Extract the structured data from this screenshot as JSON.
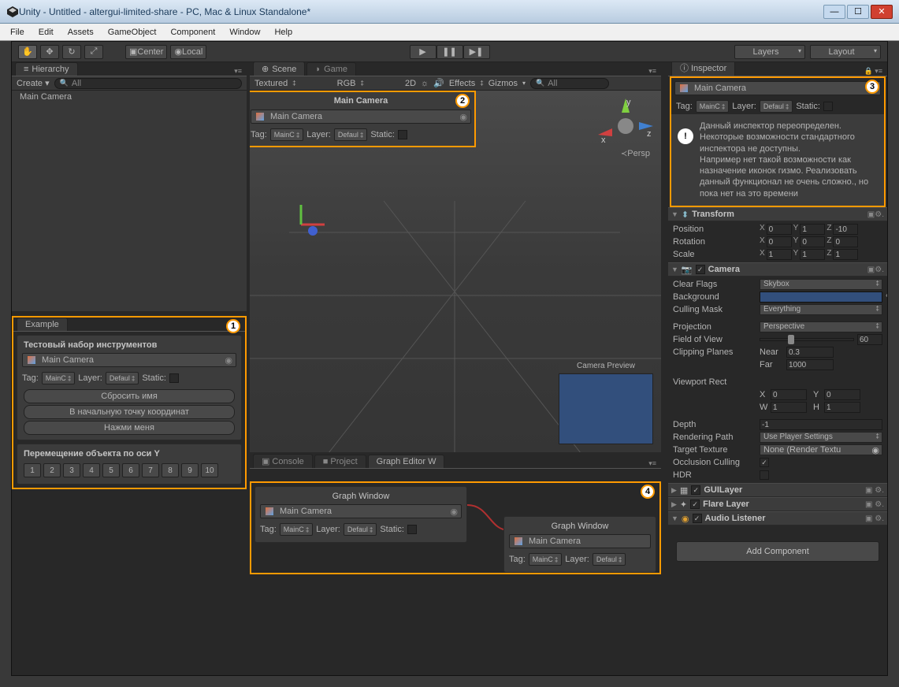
{
  "window": {
    "title": "Unity - Untitled - altergui-limited-share - PC, Mac & Linux Standalone*"
  },
  "menu": [
    "File",
    "Edit",
    "Assets",
    "GameObject",
    "Component",
    "Window",
    "Help"
  ],
  "toolbar": {
    "center": "Center",
    "local": "Local",
    "layers": "Layers",
    "layout": "Layout"
  },
  "hierarchy": {
    "tab": "Hierarchy",
    "create": "Create",
    "search_ph": "All",
    "items": [
      "Main Camera"
    ]
  },
  "example": {
    "tab": "Example",
    "box1_title": "Тестовый набор инструментов",
    "obj": "Main Camera",
    "tag": "Tag:",
    "tag_val": "MainC",
    "layer": "Layer:",
    "layer_val": "Defaul",
    "static": "Static:",
    "btn_reset": "Сбросить имя",
    "btn_origin": "В начальную точку координат",
    "btn_press": "Нажми меня",
    "box2_title": "Перемещение объекта по оси Y",
    "nums": [
      "1",
      "2",
      "3",
      "4",
      "5",
      "6",
      "7",
      "8",
      "9",
      "10"
    ]
  },
  "scene": {
    "tab_scene": "Scene",
    "tab_game": "Game",
    "shading": "Textured",
    "rgb": "RGB",
    "mode2d": "2D",
    "effects": "Effects",
    "gizmos": "Gizmos",
    "search_ph": "All",
    "persp": "Persp",
    "popup_title": "Main Camera",
    "popup_obj": "Main Camera",
    "tag": "Tag:",
    "tag_val": "MainC",
    "layer": "Layer:",
    "layer_val": "Defaul",
    "static": "Static:",
    "cam_preview": "Camera Preview"
  },
  "bottom": {
    "tab_console": "Console",
    "tab_project": "Project",
    "tab_graph": "Graph Editor W",
    "node_title": "Graph Window",
    "obj": "Main Camera",
    "tag": "Tag:",
    "tag_val": "MainC",
    "layer": "Layer:",
    "layer_val": "Defaul",
    "static": "Static:"
  },
  "inspector": {
    "tab": "Inspector",
    "obj": "Main Camera",
    "tag": "Tag:",
    "tag_val": "MainC",
    "layer": "Layer:",
    "layer_val": "Defaul",
    "static": "Static:",
    "info": "Данный инспектор переопределен. Некоторые возможности стандартного инспектора не доступны.\nНапример нет такой возможности как назначение иконок гизмо. Реализовать данный функционал не очень сложно., но пока нет на это времени",
    "transform": {
      "name": "Transform",
      "pos_label": "Position",
      "pos": {
        "x": "0",
        "y": "1",
        "z": "-10"
      },
      "rot_label": "Rotation",
      "rot": {
        "x": "0",
        "y": "0",
        "z": "0"
      },
      "scl_label": "Scale",
      "scl": {
        "x": "1",
        "y": "1",
        "z": "1"
      }
    },
    "camera": {
      "name": "Camera",
      "clear_flags": "Clear Flags",
      "clear_flags_v": "Skybox",
      "background": "Background",
      "culling": "Culling Mask",
      "culling_v": "Everything",
      "projection": "Projection",
      "projection_v": "Perspective",
      "fov": "Field of View",
      "fov_v": "60",
      "clipping": "Clipping Planes",
      "near": "Near",
      "near_v": "0.3",
      "far": "Far",
      "far_v": "1000",
      "viewport": "Viewport Rect",
      "vx": "X",
      "vx_v": "0",
      "vy": "Y",
      "vy_v": "0",
      "vw": "W",
      "vw_v": "1",
      "vh": "H",
      "vh_v": "1",
      "depth": "Depth",
      "depth_v": "-1",
      "rendering": "Rendering Path",
      "rendering_v": "Use Player Settings",
      "target": "Target Texture",
      "target_v": "None (Render Textu",
      "occlusion": "Occlusion Culling",
      "hdr": "HDR"
    },
    "guilayer": "GUILayer",
    "flare": "Flare Layer",
    "audio": "Audio Listener",
    "add_component": "Add Component"
  },
  "callouts": {
    "1": "1",
    "2": "2",
    "3": "3",
    "4": "4"
  }
}
